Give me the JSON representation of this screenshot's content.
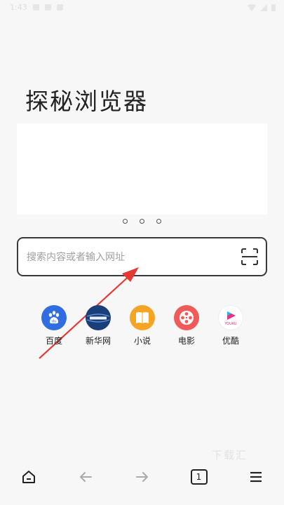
{
  "status_bar": {
    "time": "1:43"
  },
  "app_title": "探秘浏览器",
  "search": {
    "placeholder": "搜索内容或者输入网址"
  },
  "quick_links": [
    {
      "label": "百度",
      "icon": "baidu-paw-icon",
      "color": "#2f6de1"
    },
    {
      "label": "新华网",
      "icon": "xinhua-globe-icon",
      "color": "#1a3e7a"
    },
    {
      "label": "小说",
      "icon": "book-icon",
      "color": "#f4a523"
    },
    {
      "label": "电影",
      "icon": "film-reel-icon",
      "color": "#f05a5a"
    },
    {
      "label": "优酷",
      "icon": "youku-icon",
      "color": "#ffffff"
    }
  ],
  "bottom_nav": {
    "tab_count": "1"
  },
  "watermark": "下载汇",
  "colors": {
    "accent_arrow": "#e53935",
    "border": "#3a3a3a",
    "background": "#f7f7f7"
  }
}
